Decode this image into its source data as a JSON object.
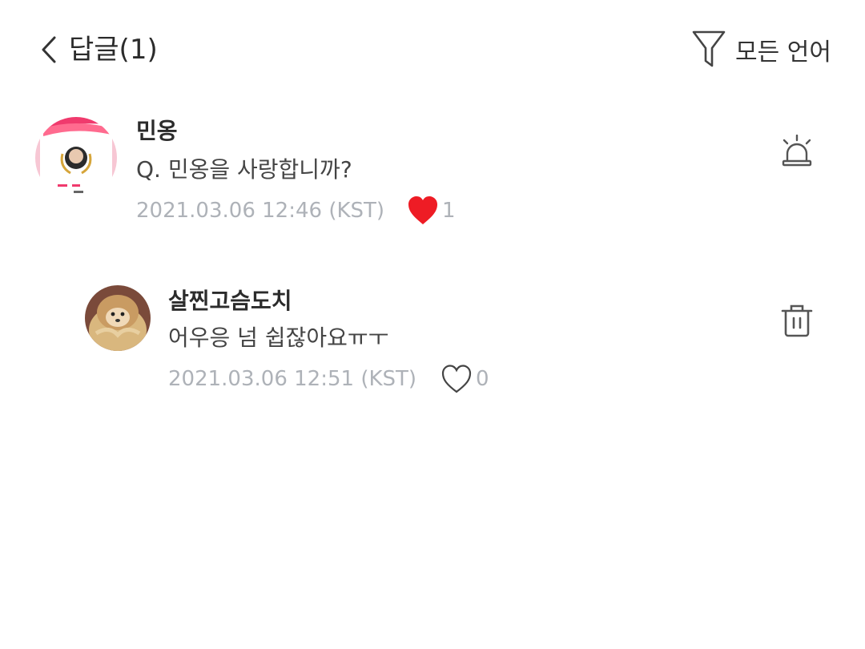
{
  "header": {
    "title": "답글(1)",
    "filter_label": "모든 언어"
  },
  "comment": {
    "username": "민옹",
    "text": "Q. 민옹을 사랑합니까?",
    "timestamp": "2021.03.06 12:46 (KST)",
    "likes": "1",
    "liked": true,
    "like_color": "#ee1c25",
    "action_icon": "report-siren-icon"
  },
  "reply": {
    "username": "살찐고슴도치",
    "text": "어우응 넘 쉽잖아요ㅠㅜ",
    "timestamp": "2021.03.06 12:51 (KST)",
    "likes": "0",
    "liked": false,
    "action_icon": "trash-icon"
  },
  "colors": {
    "meta_gray": "#aeb2b8",
    "accent_pink": "#f03a6d"
  }
}
